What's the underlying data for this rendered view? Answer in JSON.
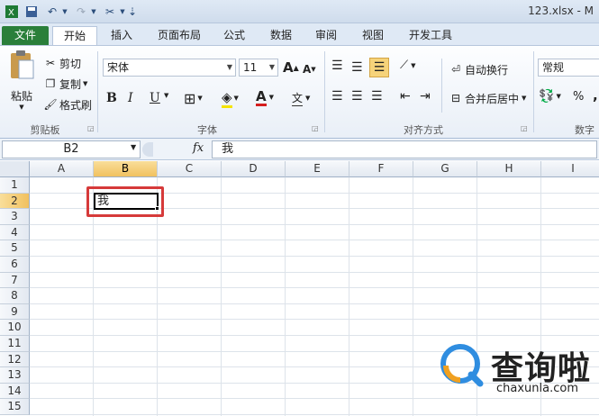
{
  "window": {
    "title": "123.xlsx - M"
  },
  "tabs": [
    {
      "name": "tab-file",
      "label": "文件"
    },
    {
      "name": "tab-home",
      "label": "开始"
    },
    {
      "name": "tab-insert",
      "label": "插入"
    },
    {
      "name": "tab-page-layout",
      "label": "页面布局"
    },
    {
      "name": "tab-formulas",
      "label": "公式"
    },
    {
      "name": "tab-data",
      "label": "数据"
    },
    {
      "name": "tab-review",
      "label": "审阅"
    },
    {
      "name": "tab-view",
      "label": "视图"
    },
    {
      "name": "tab-developer",
      "label": "开发工具"
    }
  ],
  "clipboard": {
    "paste_label": "粘贴",
    "cut_label": "剪切",
    "copy_label": "复制",
    "format_painter_label": "格式刷",
    "group_label": "剪贴板"
  },
  "font": {
    "font_name": "宋体",
    "font_size": "11",
    "grow_label": "A",
    "shrink_label": "A",
    "bold_label": "B",
    "italic_label": "I",
    "underline_label": "U",
    "phonetic_label": "文",
    "color_label": "A",
    "group_label": "字体"
  },
  "alignment": {
    "wrap_label": "自动换行",
    "merge_label": "合并后居中",
    "group_label": "对齐方式"
  },
  "number": {
    "format": "常规",
    "percent_label": "%",
    "comma_label": ",",
    "group_label": "数字"
  },
  "formula_bar": {
    "name_box": "B2",
    "fx_label": "fx",
    "value": "我"
  },
  "grid": {
    "columns": [
      "A",
      "B",
      "C",
      "D",
      "E",
      "F",
      "G",
      "H",
      "I"
    ],
    "rows": [
      "1",
      "2",
      "3",
      "4",
      "5",
      "6",
      "7",
      "8",
      "9",
      "10",
      "11",
      "12",
      "13",
      "14",
      "15"
    ],
    "active_column": "B",
    "active_row": "2",
    "cell_b2": "我"
  },
  "watermark": {
    "brand_cn": "查询啦",
    "brand_en": "chaxunla.com"
  },
  "colors": {
    "file_tab": "#2a7f3a",
    "highlight": "#d63a3a",
    "active_header": "#f1c15f"
  }
}
